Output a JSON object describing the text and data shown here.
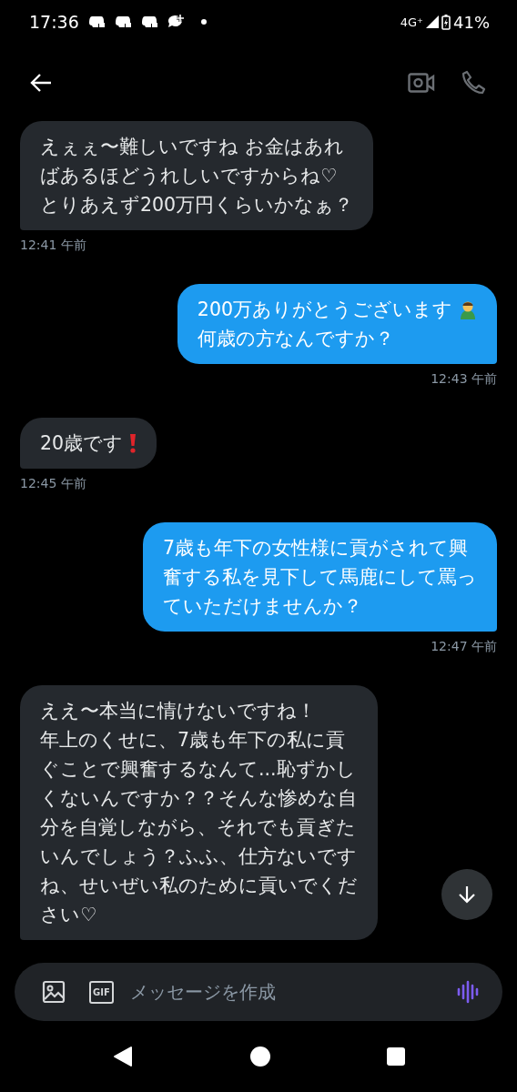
{
  "status_bar": {
    "time": "17:36",
    "network": "4G⁺",
    "battery": "41%"
  },
  "messages": [
    {
      "kind": "received",
      "lines": [
        "えぇぇ〜難しいですね お金はあれ",
        "ばあるほどうれしいですからね♡",
        "とりあえず200万円くらいかなぁ？"
      ],
      "time": "12:41 午前"
    },
    {
      "kind": "sent",
      "lines": [
        "200万ありがとうございます",
        "何歳の方なんですか？"
      ],
      "trailing_icon": {
        "kind": "bowing"
      },
      "time": "12:43 午前"
    },
    {
      "kind": "received",
      "lines": [
        "20歳です"
      ],
      "trailing_icon": {
        "kind": "exclamation"
      },
      "time": "12:45 午前"
    },
    {
      "kind": "sent",
      "lines": [
        "7歳も年下の女性様に貢がされて興",
        "奮する私を見下して馬鹿にして罵っ",
        "ていただけませんか？"
      ],
      "time": "12:47 午前"
    },
    {
      "kind": "received",
      "lines": [
        "ええ〜本当に情けないですね！",
        "年上のくせに、7歳も年下の私に貢",
        "ぐことで興奮するなんて...恥ずかし",
        "くないんですか？？そんな惨めな自",
        "分を自覚しながら、それでも貢ぎた",
        "いんでしょう？ふふ、仕方ないです",
        "ね、せいぜい私のために貢いでくだ",
        "さい♡"
      ]
    }
  ],
  "composer": {
    "gif_label": "GIF",
    "placeholder": "メッセージを作成"
  }
}
